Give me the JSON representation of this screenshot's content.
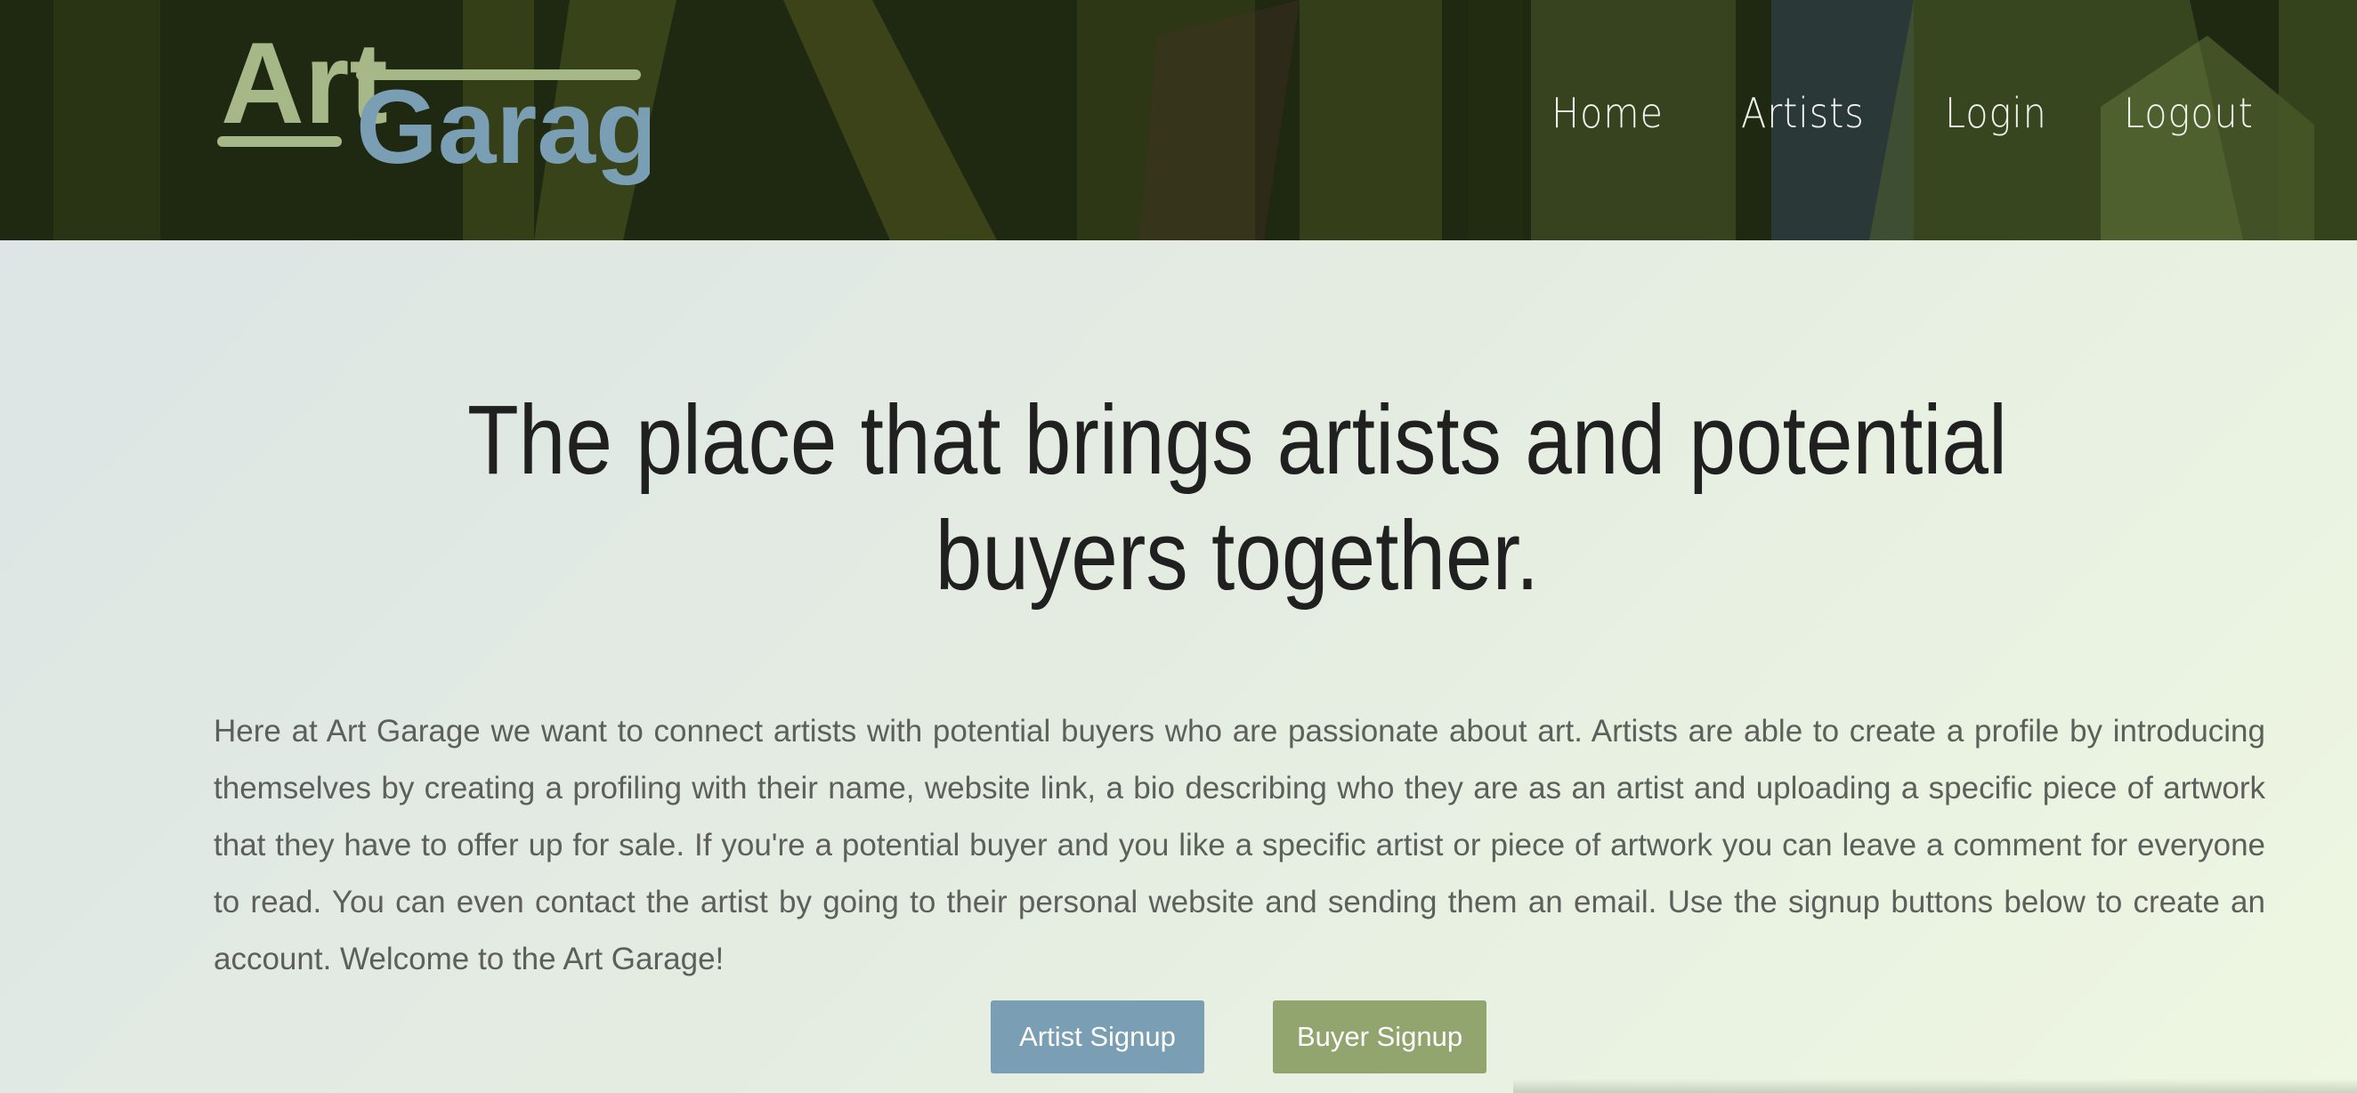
{
  "brand": {
    "logo_word1": "Art",
    "logo_word2": "Garage",
    "colors": {
      "logo_art": "#a7b888",
      "logo_garage": "#7a9fb4"
    }
  },
  "nav": {
    "items": [
      {
        "label": "Home"
      },
      {
        "label": "Artists"
      },
      {
        "label": "Login"
      },
      {
        "label": "Logout"
      }
    ]
  },
  "hero": {
    "headline": "The place that brings artists and potential buyers together.",
    "intro": "Here at Art Garage we want to connect artists with potential buyers who are passionate about art. Artists are able to create a profile by introducing themselves by creating a profiling with their name, website link, a bio describing who they are as an artist and uploading a specific piece of artwork that they have to offer up for sale. If you're a potential buyer and you like a specific artist or piece of artwork you can leave a comment for everyone to read. You can even contact the artist by going to their personal website and sending them an email. Use the signup buttons below to create an account. Welcome to the Art Garage!"
  },
  "actions": {
    "artist_signup": "Artist Signup",
    "buyer_signup": "Buyer Signup",
    "colors": {
      "artist": "#7a9fb4",
      "buyer": "#92a56f"
    }
  }
}
